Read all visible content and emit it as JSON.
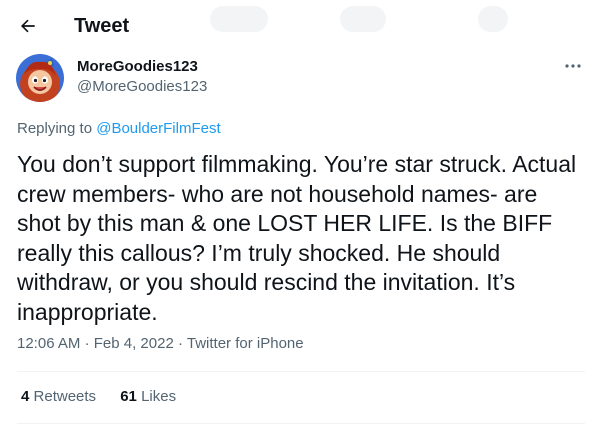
{
  "header": {
    "title": "Tweet",
    "back_icon": "arrow-left-icon"
  },
  "author": {
    "display_name": "MoreGoodies123",
    "handle": "@MoreGoodies123",
    "avatar_icon": "cartoon-avatar"
  },
  "reply": {
    "prefix": "Replying to",
    "target": "@BoulderFilmFest"
  },
  "tweet": {
    "text": "You don’t support filmmaking. You’re star struck. Actual crew members- who are not household names- are shot by this man & one LOST HER LIFE. Is the BIFF really this callous? I’m truly shocked. He should withdraw, or you should rescind the invitation. It’s inappropriate."
  },
  "meta": {
    "time": "12:06 AM",
    "date": "Feb 4, 2022",
    "source": "Twitter for iPhone",
    "separator": "·"
  },
  "stats": {
    "retweets_count": "4",
    "retweets_label": "Retweets",
    "likes_count": "61",
    "likes_label": "Likes"
  },
  "colors": {
    "accent": "#1d9bf0",
    "text": "#0f1419",
    "secondary": "#536471",
    "divider": "#eff3f4"
  }
}
